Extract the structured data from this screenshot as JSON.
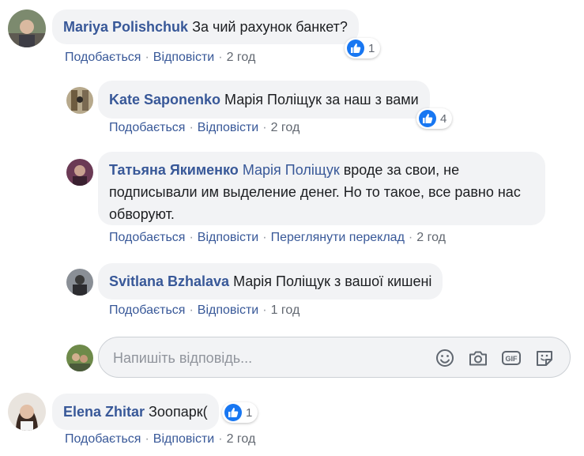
{
  "comments": [
    {
      "author": "Mariya Polishchuk",
      "text": "За чий рахунок банкет?",
      "like": "Подобається",
      "reply": "Відповісти",
      "time": "2 год",
      "reactions": "1"
    },
    {
      "author": "Kate Saponenko",
      "text": "Марія Поліщук за наш з вами",
      "like": "Подобається",
      "reply": "Відповісти",
      "time": "2 год",
      "reactions": "4"
    },
    {
      "author": "Татьяна Якименко",
      "mention": "Марія Поліщук",
      "text": " вроде за свои, не подписывали им выделение денег. Но то такое, все равно нас обворуют.",
      "like": "Подобається",
      "reply": "Відповісти",
      "translate": "Переглянути переклад",
      "time": "2 год"
    },
    {
      "author": "Svitlana Bzhalava",
      "text": "Марія Поліщук з вашої кишені",
      "like": "Подобається",
      "reply": "Відповісти",
      "time": "1 год"
    },
    {
      "author": "Elena Zhitar",
      "text": "Зоопарк(",
      "like": "Подобається",
      "reply": "Відповісти",
      "time": "2 год",
      "reactions": "1"
    }
  ],
  "reply_box": {
    "placeholder": "Напишіть відповідь...",
    "icons": [
      "emoji-icon",
      "camera-icon",
      "gif-icon",
      "sticker-icon"
    ]
  },
  "separator": "·",
  "colors": {
    "link": "#385898",
    "bubble": "#f2f3f5",
    "like_blue": "#1877f2",
    "muted": "#616770"
  }
}
